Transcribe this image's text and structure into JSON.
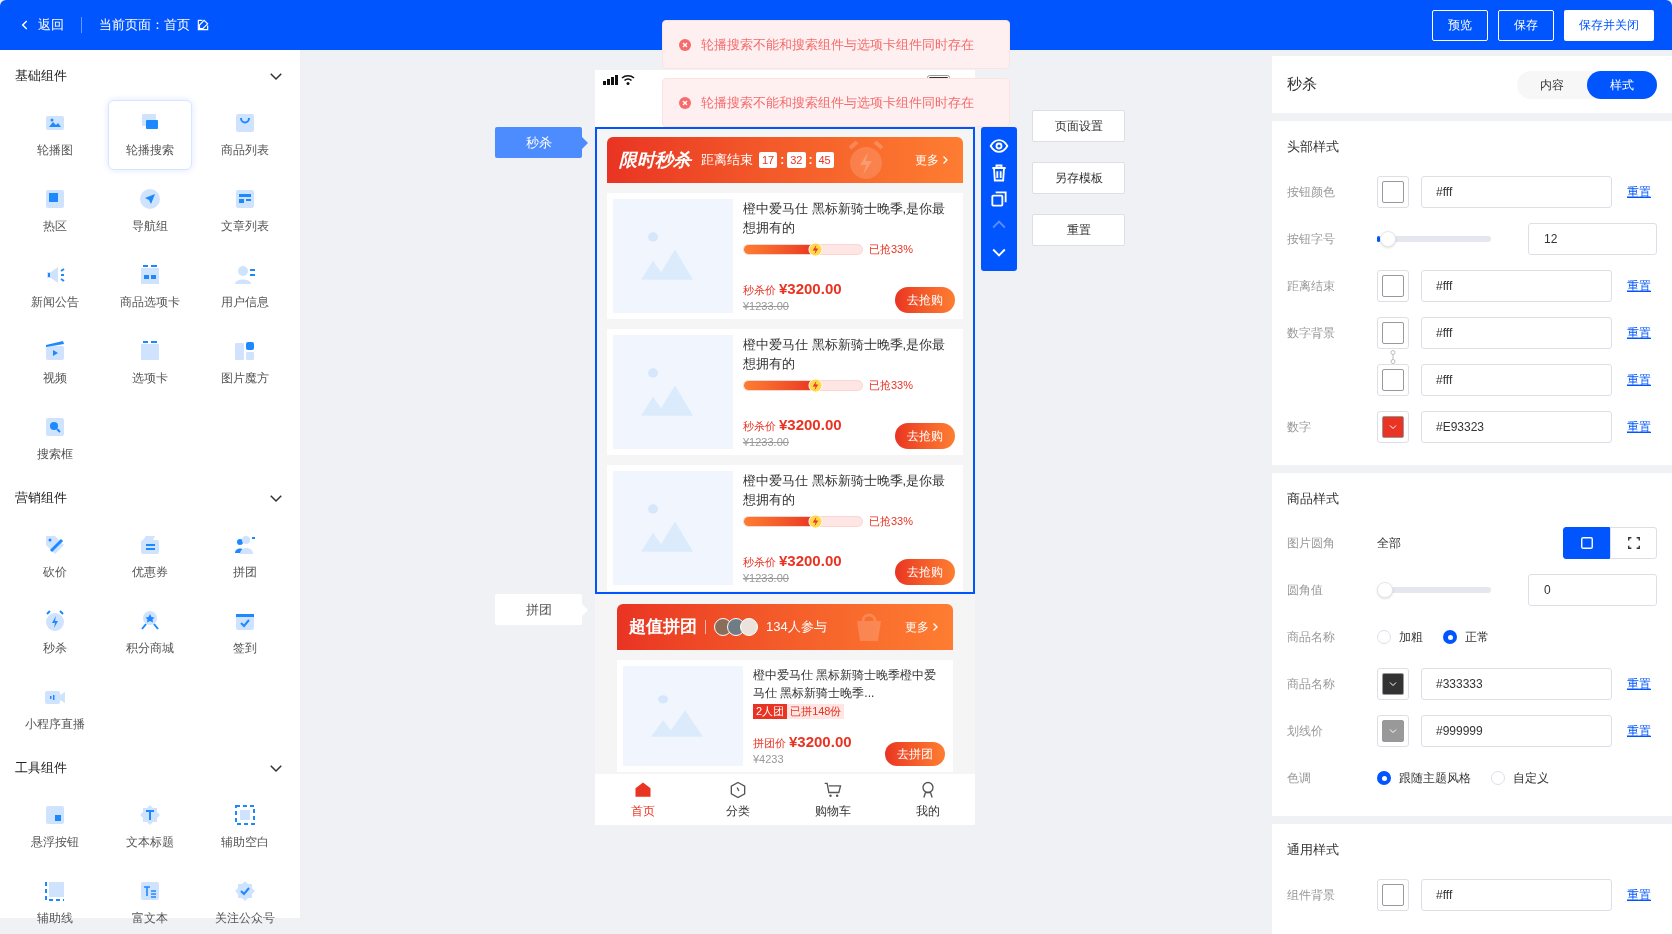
{
  "top_bar": {
    "back": "返回",
    "current_page": "当前页面：首页",
    "buttons": [
      {
        "label": "预览",
        "kind": "outline"
      },
      {
        "label": "保存",
        "kind": "outline"
      },
      {
        "label": "保存并关闭",
        "kind": "solid"
      }
    ]
  },
  "toasts": [
    "轮播搜索不能和搜索组件与选项卡组件同时存在",
    "轮播搜索不能和搜索组件与选项卡组件同时存在"
  ],
  "sidebar": {
    "groups": [
      {
        "title": "基础组件",
        "expanded": true,
        "items": [
          {
            "label": "轮播图",
            "selected": false
          },
          {
            "label": "轮播搜索",
            "selected": true
          },
          {
            "label": "商品列表",
            "selected": false
          },
          {
            "label": "热区",
            "selected": false
          },
          {
            "label": "导航组",
            "selected": false
          },
          {
            "label": "文章列表",
            "selected": false
          },
          {
            "label": "新闻公告",
            "selected": false
          },
          {
            "label": "商品选项卡",
            "selected": false
          },
          {
            "label": "用户信息",
            "selected": false
          },
          {
            "label": "视频",
            "selected": false
          },
          {
            "label": "选项卡",
            "selected": false
          },
          {
            "label": "图片魔方",
            "selected": false
          },
          {
            "label": "搜索框",
            "selected": false
          }
        ]
      },
      {
        "title": "营销组件",
        "expanded": true,
        "items": [
          {
            "label": "砍价",
            "selected": false
          },
          {
            "label": "优惠券",
            "selected": false
          },
          {
            "label": "拼团",
            "selected": false
          },
          {
            "label": "秒杀",
            "selected": false
          },
          {
            "label": "积分商城",
            "selected": false
          },
          {
            "label": "签到",
            "selected": false
          },
          {
            "label": "小程序直播",
            "selected": false
          }
        ]
      },
      {
        "title": "工具组件",
        "expanded": true,
        "items": [
          {
            "label": "悬浮按钮",
            "selected": false
          },
          {
            "label": "文本标题",
            "selected": false
          },
          {
            "label": "辅助空白",
            "selected": false
          },
          {
            "label": "辅助线",
            "selected": false
          },
          {
            "label": "富文本",
            "selected": false
          },
          {
            "label": "关注公众号",
            "selected": false
          }
        ]
      }
    ]
  },
  "canvas": {
    "component_tags": [
      {
        "label": "秒杀",
        "selected": true
      },
      {
        "label": "拼团",
        "selected": false
      }
    ],
    "toolbar": [
      {
        "disabled": false
      },
      {
        "disabled": false
      },
      {
        "disabled": false
      },
      {
        "disabled": true
      },
      {
        "disabled": false
      }
    ],
    "page_buttons": [
      "页面设置",
      "另存模板",
      "重置"
    ],
    "seckill": {
      "title": "限时秒杀",
      "countdown_label": "距离结束",
      "countdown": [
        "17",
        ":",
        "32",
        ":",
        "45"
      ],
      "more": "更多",
      "items": [
        {
          "name": "橙中爱马仕 黑标新骑士晚季,是你最想拥有的",
          "level": 0.6,
          "sold": "已抢33%",
          "price_label": "秒杀价",
          "price": "¥3200.00",
          "original_price": "¥1233.00",
          "button": "去抢购"
        },
        {
          "name": "橙中爱马仕 黑标新骑士晚季,是你最想拥有的",
          "level": 0.6,
          "sold": "已抢33%",
          "price_label": "秒杀价",
          "price": "¥3200.00",
          "original_price": "¥1233.00",
          "button": "去抢购"
        },
        {
          "name": "橙中爱马仕 黑标新骑士晚季,是你最想拥有的",
          "level": 0.6,
          "sold": "已抢33%",
          "price_label": "秒杀价",
          "price": "¥3200.00",
          "original_price": "¥1233.00",
          "button": "去抢购"
        }
      ]
    },
    "group_buy": {
      "title": "超值拼团",
      "participants": "134人参与",
      "more": "更多",
      "items": [
        {
          "name": "橙中爱马仕 黑标新骑士晚季橙中爱马仕 黑标新骑士晚季...",
          "team": "2人团",
          "joined": "已拼148份",
          "price_label": "拼团价",
          "price": "¥3200.00",
          "original_price": "¥4233",
          "button": "去拼团"
        }
      ]
    },
    "tab_bar": [
      {
        "label": "首页",
        "selected": true
      },
      {
        "label": "分类",
        "selected": false
      },
      {
        "label": "购物车",
        "selected": false
      },
      {
        "label": "我的",
        "selected": false
      }
    ]
  },
  "settings": {
    "title": "秒杀",
    "tabs": [
      {
        "label": "内容",
        "selected": false
      },
      {
        "label": "样式",
        "selected": true
      }
    ],
    "sections": [
      {
        "title": "头部样式",
        "rows": [
          {
            "kind": "color",
            "label": "按钮颜色",
            "color": "#ffffff",
            "value": "#fff",
            "reset": "重置"
          },
          {
            "kind": "slider",
            "label": "按钮字号",
            "level": 0.03,
            "value": "12"
          },
          {
            "kind": "color",
            "label": "距离结束",
            "color": "#ffffff",
            "value": "#fff",
            "reset": "重置"
          },
          {
            "kind": "color_pair",
            "label": "数字背景",
            "colors": [
              {
                "color": "#ffffff",
                "value": "#fff",
                "reset": "重置"
              },
              {
                "color": "#ffffff",
                "value": "#fff",
                "reset": "重置"
              }
            ]
          },
          {
            "kind": "color",
            "label": "数字",
            "color": "#e93323",
            "value": "#E93323",
            "reset": "重置"
          }
        ]
      },
      {
        "title": "商品样式",
        "rows": [
          {
            "kind": "corner",
            "label": "图片圆角",
            "value": "全部",
            "options": [
              {
                "selected": true
              },
              {
                "selected": false
              }
            ]
          },
          {
            "kind": "slider",
            "label": "圆角值",
            "level": 0,
            "value": "0"
          },
          {
            "kind": "radio",
            "label": "商品名称",
            "options": [
              {
                "label": "加粗",
                "selected": false
              },
              {
                "label": "正常",
                "selected": true
              }
            ]
          },
          {
            "kind": "color",
            "label": "商品名称",
            "color": "#333333",
            "value": "#333333",
            "reset": "重置"
          },
          {
            "kind": "color",
            "label": "划线价",
            "color": "#999999",
            "value": "#999999",
            "reset": "重置"
          },
          {
            "kind": "radio",
            "label": "色调",
            "options": [
              {
                "label": "跟随主题风格",
                "selected": true
              },
              {
                "label": "自定义",
                "selected": false
              }
            ]
          }
        ]
      },
      {
        "title": "通用样式",
        "rows": [
          {
            "kind": "color",
            "label": "组件背景",
            "color": "#ffffff",
            "value": "#fff",
            "reset": "重置"
          }
        ]
      }
    ]
  }
}
